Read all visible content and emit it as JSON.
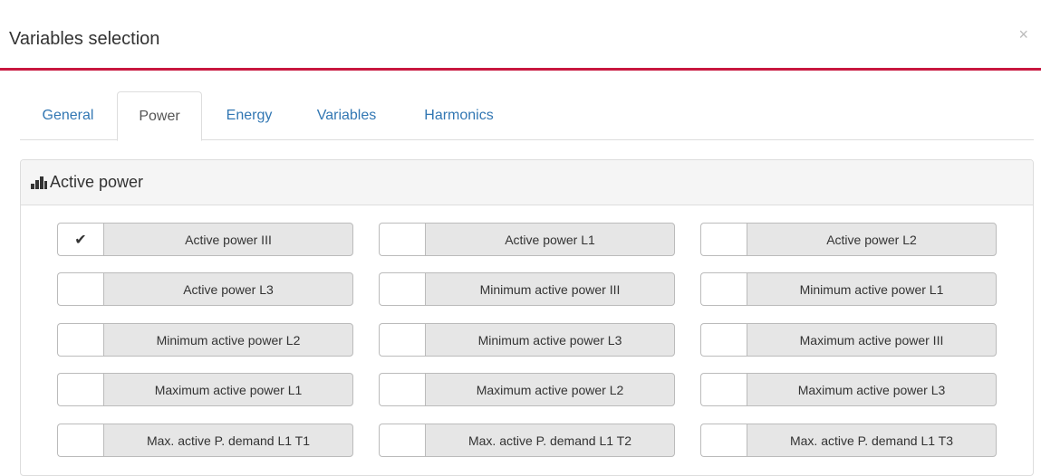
{
  "dialog": {
    "title": "Variables selection",
    "close_label": "×",
    "accent_color": "#c8173f"
  },
  "tabs": [
    {
      "label": "General",
      "active": false
    },
    {
      "label": "Power",
      "active": true
    },
    {
      "label": "Energy",
      "active": false
    },
    {
      "label": "Variables",
      "active": false
    },
    {
      "label": "Harmonics",
      "active": false
    }
  ],
  "panel": {
    "title": "Active power",
    "icon": "bar-chart-icon"
  },
  "variables": [
    {
      "label": "Active power III",
      "checked": true
    },
    {
      "label": "Active power L1",
      "checked": false
    },
    {
      "label": "Active power L2",
      "checked": false
    },
    {
      "label": "Active power L3",
      "checked": false
    },
    {
      "label": "Minimum active power III",
      "checked": false
    },
    {
      "label": "Minimum active power L1",
      "checked": false
    },
    {
      "label": "Minimum active power L2",
      "checked": false
    },
    {
      "label": "Minimum active power L3",
      "checked": false
    },
    {
      "label": "Maximum active power III",
      "checked": false
    },
    {
      "label": "Maximum active power L1",
      "checked": false
    },
    {
      "label": "Maximum active power L2",
      "checked": false
    },
    {
      "label": "Maximum active power L3",
      "checked": false
    },
    {
      "label": "Max. active P. demand L1 T1",
      "checked": false
    },
    {
      "label": "Max. active P. demand L1 T2",
      "checked": false
    },
    {
      "label": "Max. active P. demand L1 T3",
      "checked": false
    }
  ],
  "check_glyph": "✔"
}
